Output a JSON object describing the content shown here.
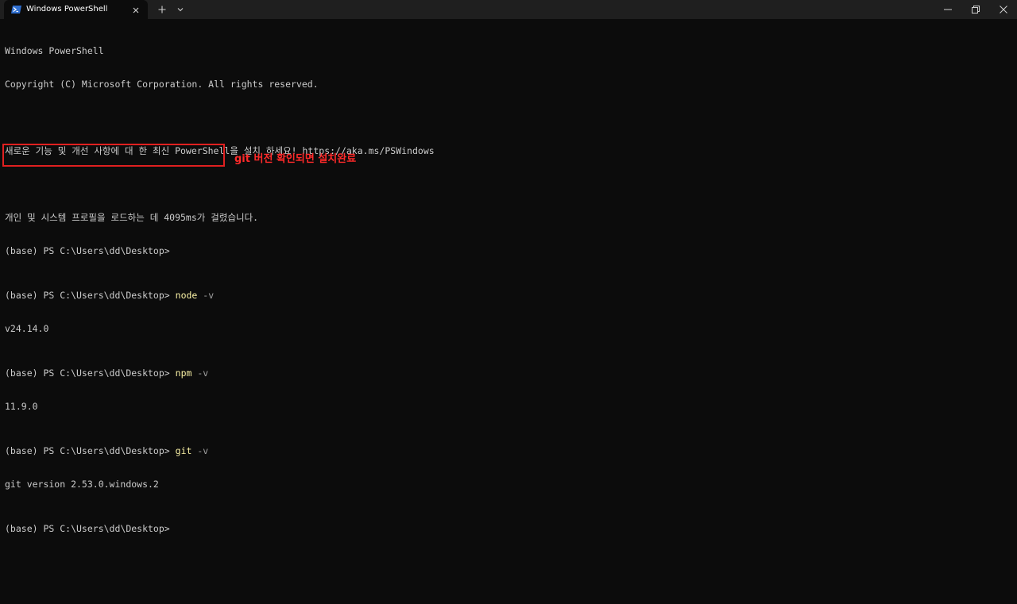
{
  "window": {
    "tab_title": "Windows PowerShell",
    "tab_icon": "powershell-icon",
    "new_tab_icon": "plus-icon",
    "dropdown_icon": "chevron-down-icon",
    "controls": [
      "minimize-icon",
      "maximize-icon",
      "close-icon"
    ],
    "colors": {
      "titlebar": "#1f1f1f",
      "background": "#0c0c0c",
      "text": "#cccccc",
      "command": "#f9f1a5",
      "parameter": "#a0a0a0",
      "annotation": "#ff2a2a"
    }
  },
  "terminal": {
    "header_title": "Windows PowerShell",
    "copyright": "Copyright (C) Microsoft Corporation. All rights reserved.",
    "update_notice": "새로운 기능 및 개선 사항에 대 한 최신 PowerShell을 설치 하세요! https://aka.ms/PSWindows",
    "profile_notice": "개인 및 시스템 프로필을 로드하는 데 4095ms가 걸렸습니다.",
    "prompt": "(base) PS C:\\Users\\dd\\Desktop>",
    "commands": [
      {
        "cmd": "node",
        "arg": "-v",
        "output": "v24.14.0"
      },
      {
        "cmd": "npm",
        "arg": "-v",
        "output": "11.9.0"
      },
      {
        "cmd": "git",
        "arg": "-v",
        "output": "git version 2.53.0.windows.2"
      }
    ]
  },
  "annotation": {
    "text": "git 버전 확인되면 설치완료"
  }
}
